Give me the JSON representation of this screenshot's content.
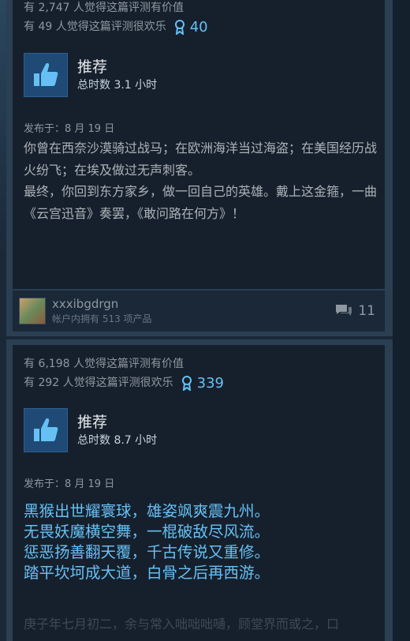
{
  "reviews": [
    {
      "helpful_text": "有 2,747 人觉得这篇评测有价值",
      "funny_text": "有 49 人觉得这篇评测很欢乐",
      "award_count": "40",
      "verdict": "推荐",
      "hours": "总时数 3.1 小时",
      "posted": "发布于：8 月 19 日",
      "paragraphs": [
        "你曾在西奈沙漠骑过战马；在欧洲海洋当过海盗；在美国经历战火纷飞；在埃及做过无声刺客。",
        "最终，你回到东方家乡，做一回自己的英雄。戴上这金箍，一曲《云宫迅音》奏罢，《敢问路在何方》！"
      ],
      "author": "xxxibgdrgn",
      "products_owned": "帐户内拥有 513 项产品",
      "comment_count": "11"
    },
    {
      "helpful_text": "有 6,198 人觉得这篇评测有价值",
      "funny_text": "有 292 人觉得这篇评测很欢乐",
      "award_count": "339",
      "verdict": "推荐",
      "hours": "总时数 8.7 小时",
      "posted": "发布于：8 月 19 日",
      "poem_lines": [
        "黑猴出世耀寰球，雄姿飒爽震九州。",
        "无畏妖魔横空舞，一棍破敌尽风流。",
        "惩恶扬善翻天覆，千古传说又重修。",
        "踏平坎坷成大道，白骨之后再西游。"
      ],
      "faded_text": "庚子年七月初二，余与常入咄咄咄嗵，顾堂界而或之，口"
    }
  ],
  "colors": {
    "accent": "#66c0f4",
    "card_bg": "#16202d"
  }
}
